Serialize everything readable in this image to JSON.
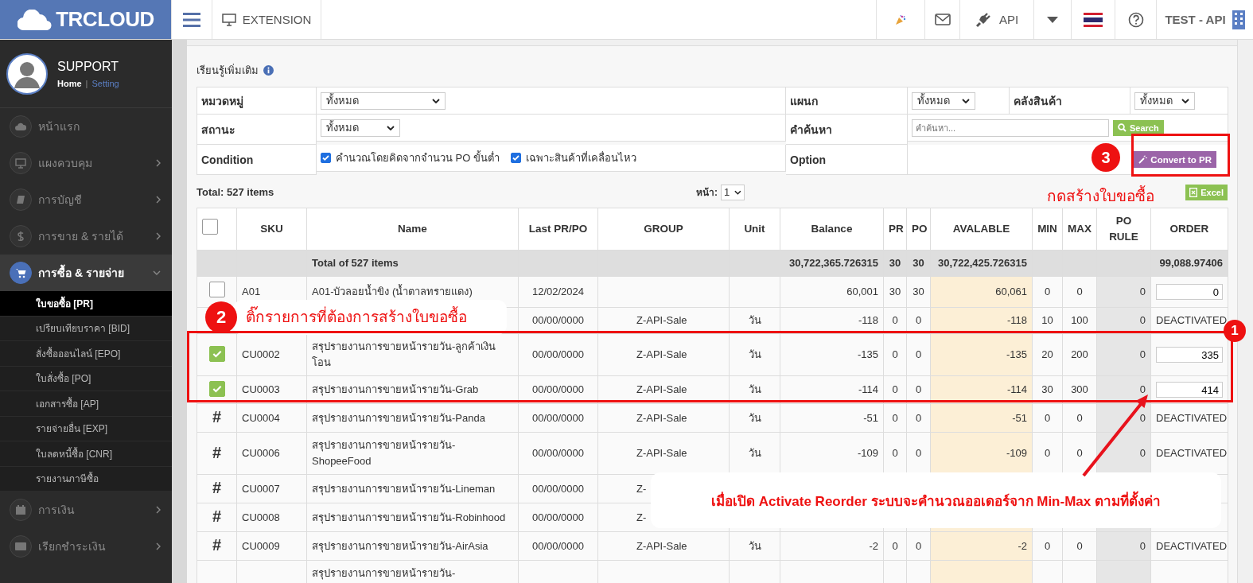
{
  "topbar": {
    "logo": "TRCLOUD",
    "extension": "EXTENSION",
    "api": "API",
    "user": "TEST - API"
  },
  "sidebar": {
    "user": "SUPPORT",
    "home": "Home",
    "separator": "|",
    "setting": "Setting",
    "items": [
      {
        "label": "หน้าแรก",
        "selected": false
      },
      {
        "label": "แผงควบคุม",
        "selected": false,
        "expanded": false
      },
      {
        "label": "การบัญชี",
        "selected": false,
        "expanded": false
      },
      {
        "label": "การขาย & รายได้",
        "selected": false,
        "expanded": false
      },
      {
        "label": "การซื้อ & รายจ่าย",
        "selected": true,
        "expanded": true,
        "children": [
          {
            "label": "ใบขอซื้อ [PR]",
            "selected": true
          },
          {
            "label": "เปรียบเทียบราคา [BID]",
            "selected": false
          },
          {
            "label": "สั่งซื้อออนไลน์ [EPO]",
            "selected": false
          },
          {
            "label": "ใบสั่งซื้อ [PO]",
            "selected": false
          },
          {
            "label": "เอกสารซื้อ [AP]",
            "selected": false
          },
          {
            "label": "รายจ่ายอื่น [EXP]",
            "selected": false
          },
          {
            "label": "ใบลดหนี้ซื้อ [CNR]",
            "selected": false
          },
          {
            "label": "รายงานภาษีซื้อ",
            "selected": false
          }
        ]
      },
      {
        "label": "การเงิน",
        "selected": false,
        "expanded": false
      },
      {
        "label": "เรียกชำระเงิน",
        "selected": false,
        "expanded": false
      }
    ]
  },
  "filters": {
    "learn_more": "เรียนรู้เพิ่มเติม",
    "category": {
      "label": "หมวดหมู่",
      "value": "ทั้งหมด"
    },
    "department": {
      "label": "แผนก",
      "value": "ทั้งหมด"
    },
    "warehouse": {
      "label": "คลังสินค้า",
      "value": "ทั้งหมด"
    },
    "status": {
      "label": "สถานะ",
      "value": "ทั้งหมด"
    },
    "search": {
      "label": "คำค้นหา",
      "placeholder": "คำค้นหา...",
      "button": "Search"
    },
    "condition": {
      "label": "Condition",
      "options": [
        {
          "label": "คำนวณโดยคิดจากจำนวน PO ขั้นต่ำ",
          "checked": true
        },
        {
          "label": "เฉพาะสินค้าที่เคลื่อนไหว",
          "checked": true
        }
      ]
    },
    "option": {
      "label": "Option",
      "button": "Convert to PR"
    }
  },
  "summary": {
    "total": "Total: 527 items",
    "page_label": "หน้า:",
    "page": "1",
    "excel": "Excel"
  },
  "table": {
    "select_all": false,
    "columns": [
      "SKU",
      "Name",
      "Last PR/PO",
      "GROUP",
      "Unit",
      "Balance",
      "PR",
      "PO",
      "AVALABLE",
      "MIN",
      "MAX",
      "PO RULE",
      "ORDER"
    ],
    "total_row": {
      "label": "Total of 527 items",
      "balance": "30,722,365.726315",
      "pr": "30",
      "po": "30",
      "available": "30,722,425.726315",
      "order": "99,088.97406"
    },
    "rows": [
      {
        "kind": "checkbox",
        "checked": false,
        "sku": "A01",
        "name": "A01-บัวลอยน้ำขิง (น้ำตาลทรายแดง)",
        "last": "12/02/2024",
        "balance": "60,001",
        "pr": "30",
        "po": "30",
        "available": "60,061",
        "min": "0",
        "max": "0",
        "po_rule": "0",
        "order": {
          "kind": "input",
          "value": "0"
        }
      },
      {
        "last": "00/00/0000",
        "group": "Z-API-Sale",
        "unit": "วัน",
        "balance": "-118",
        "pr": "0",
        "po": "0",
        "available": "-118",
        "min": "10",
        "max": "100",
        "po_rule": "0",
        "order": {
          "kind": "text",
          "value": "DEACTIVATED"
        }
      },
      {
        "kind": "checkbox",
        "checked": true,
        "sku": "CU0002",
        "name": "สรุปรายงานการขายหน้ารายวัน-ลูกค้าเงินโอน",
        "last": "00/00/0000",
        "group": "Z-API-Sale",
        "unit": "วัน",
        "balance": "-135",
        "pr": "0",
        "po": "0",
        "available": "-135",
        "min": "20",
        "max": "200",
        "po_rule": "0",
        "order": {
          "kind": "input",
          "value": "335"
        }
      },
      {
        "kind": "checkbox",
        "checked": true,
        "sku": "CU0003",
        "name": "สรุปรายงานการขายหน้ารายวัน-Grab",
        "last": "00/00/0000",
        "group": "Z-API-Sale",
        "unit": "วัน",
        "balance": "-114",
        "pr": "0",
        "po": "0",
        "available": "-114",
        "min": "30",
        "max": "300",
        "po_rule": "0",
        "order": {
          "kind": "input",
          "value": "414"
        }
      },
      {
        "kind": "marker",
        "marker": "#",
        "sku": "CU0004",
        "name": "สรุปรายงานการขายหน้ารายวัน-Panda",
        "last": "00/00/0000",
        "group": "Z-API-Sale",
        "unit": "วัน",
        "balance": "-51",
        "pr": "0",
        "po": "0",
        "available": "-51",
        "min": "0",
        "max": "0",
        "po_rule": "0",
        "order": {
          "kind": "text",
          "value": "DEACTIVATED"
        }
      },
      {
        "kind": "marker",
        "marker": "#",
        "sku": "CU0006",
        "name": "สรุปรายงานการขายหน้ารายวัน-ShopeeFood",
        "last": "00/00/0000",
        "group": "Z-API-Sale",
        "unit": "วัน",
        "balance": "-109",
        "pr": "0",
        "po": "0",
        "available": "-109",
        "min": "0",
        "max": "0",
        "po_rule": "0",
        "order": {
          "kind": "text",
          "value": "DEACTIVATED"
        }
      },
      {
        "kind": "marker",
        "marker": "#",
        "sku": "CU0007",
        "name": "สรุปรายงานการขายหน้ารายวัน-Lineman",
        "last": "00/00/0000",
        "group": "Z-"
      },
      {
        "kind": "marker",
        "marker": "#",
        "sku": "CU0008",
        "name": "สรุปรายงานการขายหน้ารายวัน-Robinhood",
        "last": "00/00/0000",
        "group": "Z-"
      },
      {
        "kind": "marker",
        "marker": "#",
        "sku": "CU0009",
        "name": "สรุปรายงานการขายหน้ารายวัน-AirAsia",
        "last": "00/00/0000",
        "group": "Z-API-Sale",
        "unit": "วัน",
        "balance": "-2",
        "pr": "0",
        "po": "0",
        "available": "-2",
        "min": "0",
        "max": "0",
        "po_rule": "0",
        "order": {
          "kind": "text",
          "value": "DEACTIVATED"
        }
      },
      {
        "name": "สรุปรายงานการขายหน้ารายวัน-"
      }
    ]
  },
  "callouts": {
    "convert": {
      "badge": "3",
      "note": "กดสร้างใบขอซื้อ"
    },
    "tick": {
      "badge": "2",
      "note": "ติ๊กรายการที่ต้องการสร้างใบขอซื้อ"
    },
    "reorder": {
      "badge": "1",
      "note": "เมื่อเปิด Activate Reorder ระบบจะคำนวณออเดอร์จาก Min-Max ตามที่ตั้งค่า"
    }
  }
}
